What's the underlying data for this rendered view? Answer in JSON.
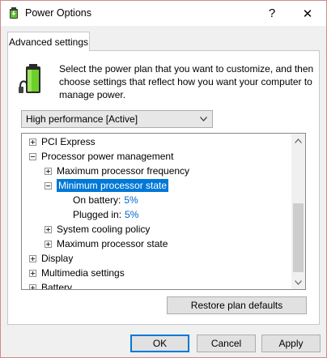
{
  "window": {
    "title": "Power Options",
    "help_glyph": "?",
    "close_glyph": "✕"
  },
  "tab": {
    "label": "Advanced settings"
  },
  "description": "Select the power plan that you want to customize, and then choose settings that reflect how you want your computer to manage power.",
  "plan": {
    "selected": "High performance [Active]"
  },
  "tree": {
    "pci_express": "PCI Express",
    "processor_power_management": "Processor power management",
    "max_processor_frequency": "Maximum processor frequency",
    "min_processor_state": "Minimum processor state",
    "on_battery_label": "On battery:",
    "on_battery_value": "5%",
    "plugged_in_label": "Plugged in:",
    "plugged_in_value": "5%",
    "system_cooling_policy": "System cooling policy",
    "max_processor_state": "Maximum processor state",
    "display": "Display",
    "multimedia_settings": "Multimedia settings",
    "battery": "Battery"
  },
  "buttons": {
    "restore": "Restore plan defaults",
    "ok": "OK",
    "cancel": "Cancel",
    "apply": "Apply"
  },
  "icons": {
    "app": "power-options-icon",
    "battery": "battery-plug-icon"
  }
}
